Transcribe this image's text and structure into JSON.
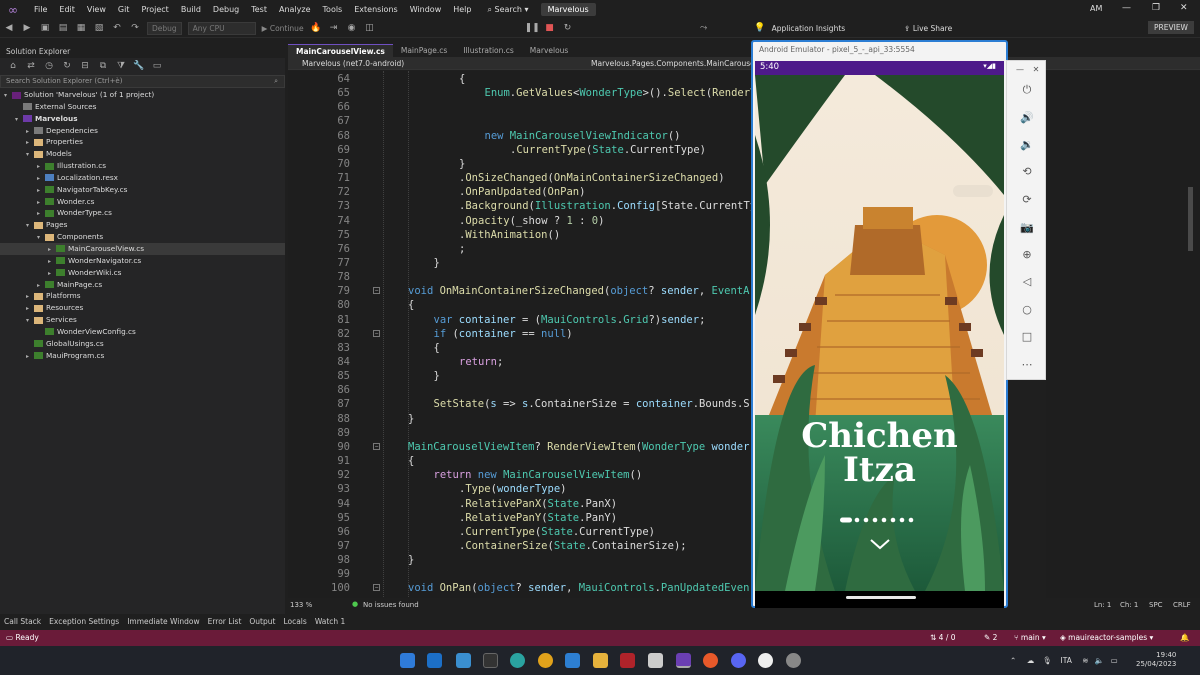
{
  "menubar": {
    "items": [
      "File",
      "Edit",
      "View",
      "Git",
      "Project",
      "Build",
      "Debug",
      "Test",
      "Analyze",
      "Tools",
      "Extensions",
      "Window",
      "Help"
    ],
    "search_label": "Search",
    "solution_badge": "Marvelous",
    "user_initials": "AM"
  },
  "toolbar": {
    "config": "Debug",
    "platform": "Any CPU",
    "continue_label": "Continue",
    "insights_label": "Application Insights",
    "live_share_label": "Live Share",
    "preview_label": "PREVIEW"
  },
  "solution_explorer": {
    "title": "Solution Explorer",
    "search_placeholder": "Search Solution Explorer (Ctrl+è)",
    "tree": [
      {
        "label": "Solution 'Marvelous' (1 of 1 project)",
        "indent": 0,
        "icon": "solution-icon",
        "arrow": "▾"
      },
      {
        "label": "External Sources",
        "indent": 1,
        "icon": "references-icon",
        "arrow": ""
      },
      {
        "label": "Marvelous",
        "indent": 1,
        "icon": "project-icon",
        "arrow": "▾",
        "bold": true
      },
      {
        "label": "Dependencies",
        "indent": 2,
        "icon": "references-icon",
        "arrow": "▸"
      },
      {
        "label": "Properties",
        "indent": 2,
        "icon": "folder-icon",
        "arrow": "▸"
      },
      {
        "label": "Models",
        "indent": 2,
        "icon": "folder-icon",
        "arrow": "▾"
      },
      {
        "label": "Illustration.cs",
        "indent": 3,
        "icon": "csharp-file-icon",
        "arrow": "▸"
      },
      {
        "label": "Localization.resx",
        "indent": 3,
        "icon": "resource-file-icon",
        "arrow": "▸"
      },
      {
        "label": "NavigatorTabKey.cs",
        "indent": 3,
        "icon": "csharp-file-icon",
        "arrow": "▸"
      },
      {
        "label": "Wonder.cs",
        "indent": 3,
        "icon": "csharp-file-icon",
        "arrow": "▸"
      },
      {
        "label": "WonderType.cs",
        "indent": 3,
        "icon": "csharp-file-icon",
        "arrow": "▸"
      },
      {
        "label": "Pages",
        "indent": 2,
        "icon": "folder-icon",
        "arrow": "▾"
      },
      {
        "label": "Components",
        "indent": 3,
        "icon": "folder-icon",
        "arrow": "▾"
      },
      {
        "label": "MainCarouselView.cs",
        "indent": 4,
        "icon": "csharp-file-icon",
        "arrow": "▸",
        "selected": true
      },
      {
        "label": "WonderNavigator.cs",
        "indent": 4,
        "icon": "csharp-file-icon",
        "arrow": "▸"
      },
      {
        "label": "WonderWiki.cs",
        "indent": 4,
        "icon": "csharp-file-icon",
        "arrow": "▸"
      },
      {
        "label": "MainPage.cs",
        "indent": 3,
        "icon": "csharp-file-icon",
        "arrow": "▸"
      },
      {
        "label": "Platforms",
        "indent": 2,
        "icon": "folder-icon",
        "arrow": "▸"
      },
      {
        "label": "Resources",
        "indent": 2,
        "icon": "folder-icon",
        "arrow": "▸"
      },
      {
        "label": "Services",
        "indent": 2,
        "icon": "folder-icon",
        "arrow": "▾"
      },
      {
        "label": "WonderViewConfig.cs",
        "indent": 3,
        "icon": "csharp-file-icon",
        "arrow": ""
      },
      {
        "label": "GlobalUsings.cs",
        "indent": 2,
        "icon": "csharp-file-icon",
        "arrow": ""
      },
      {
        "label": "MauiProgram.cs",
        "indent": 2,
        "icon": "csharp-file-icon",
        "arrow": "▸"
      }
    ]
  },
  "editor": {
    "tabs": [
      "MainCarouselView.cs",
      "MainPage.cs",
      "Illustration.cs",
      "Marvelous"
    ],
    "nav_project": "Marvelous (net7.0-android)",
    "nav_member": "Marvelous.Pages.Components.MainCarouselView",
    "zoom": "133 %",
    "issues": "No issues found",
    "cursor_line": "Ln: 1",
    "cursor_col": "Ch: 1",
    "whitespace": "SPC",
    "line_ending": "CRLF",
    "lines": [
      {
        "n": "64",
        "indent": 2,
        "fold": false,
        "t": [
          [
            "{",
            "p"
          ]
        ]
      },
      {
        "n": "65",
        "indent": 3,
        "fold": false,
        "t": [
          [
            "Enum",
            "ty"
          ],
          [
            ".",
            "p"
          ],
          [
            "GetValues",
            "m"
          ],
          [
            "<",
            "p"
          ],
          [
            "WonderType",
            "ty"
          ],
          [
            ">().",
            "p"
          ],
          [
            "Select",
            "m"
          ],
          [
            "(",
            "p"
          ],
          [
            "RenderView",
            "m"
          ]
        ]
      },
      {
        "n": "66",
        "indent": 0,
        "fold": false,
        "t": []
      },
      {
        "n": "67",
        "indent": 0,
        "fold": false,
        "t": []
      },
      {
        "n": "68",
        "indent": 3,
        "fold": false,
        "t": [
          [
            "new ",
            "k"
          ],
          [
            "MainCarouselViewIndicator",
            "ty"
          ],
          [
            "()",
            "p"
          ]
        ]
      },
      {
        "n": "69",
        "indent": 4,
        "fold": false,
        "t": [
          [
            ".",
            "p"
          ],
          [
            "CurrentType",
            "m"
          ],
          [
            "(",
            "p"
          ],
          [
            "State",
            "ty"
          ],
          [
            ".CurrentType)",
            "p"
          ]
        ]
      },
      {
        "n": "70",
        "indent": 2,
        "fold": false,
        "t": [
          [
            "}",
            "p"
          ]
        ]
      },
      {
        "n": "71",
        "indent": 2,
        "fold": false,
        "t": [
          [
            ".",
            "p"
          ],
          [
            "OnSizeChanged",
            "m"
          ],
          [
            "(",
            "p"
          ],
          [
            "OnMainContainerSizeChanged",
            "m"
          ],
          [
            ")",
            "p"
          ]
        ]
      },
      {
        "n": "72",
        "indent": 2,
        "fold": false,
        "t": [
          [
            ".",
            "p"
          ],
          [
            "OnPanUpdated",
            "m"
          ],
          [
            "(",
            "p"
          ],
          [
            "OnPan",
            "m"
          ],
          [
            ")",
            "p"
          ]
        ]
      },
      {
        "n": "73",
        "indent": 2,
        "fold": false,
        "t": [
          [
            ".",
            "p"
          ],
          [
            "Background",
            "m"
          ],
          [
            "(",
            "p"
          ],
          [
            "Illustration",
            "ty"
          ],
          [
            ".",
            "p"
          ],
          [
            "Config",
            "v"
          ],
          [
            "[State.CurrentType]",
            "p"
          ]
        ]
      },
      {
        "n": "74",
        "indent": 2,
        "fold": false,
        "t": [
          [
            ".",
            "p"
          ],
          [
            "Opacity",
            "m"
          ],
          [
            "(_show ? ",
            "p"
          ],
          [
            "1",
            "n"
          ],
          [
            " : ",
            "p"
          ],
          [
            "0",
            "n"
          ],
          [
            ")",
            "p"
          ]
        ]
      },
      {
        "n": "75",
        "indent": 2,
        "fold": false,
        "t": [
          [
            ".",
            "p"
          ],
          [
            "WithAnimation",
            "m"
          ],
          [
            "()",
            "p"
          ]
        ]
      },
      {
        "n": "76",
        "indent": 2,
        "fold": false,
        "t": [
          [
            ";",
            "p"
          ]
        ]
      },
      {
        "n": "77",
        "indent": 1,
        "fold": false,
        "t": [
          [
            "}",
            "p"
          ]
        ]
      },
      {
        "n": "78",
        "indent": 0,
        "fold": false,
        "t": []
      },
      {
        "n": "79",
        "indent": 0,
        "fold": true,
        "t": [
          [
            "void ",
            "k"
          ],
          [
            "OnMainContainerSizeChanged",
            "m"
          ],
          [
            "(",
            "p"
          ],
          [
            "object",
            "k"
          ],
          [
            "? ",
            "p"
          ],
          [
            "sender",
            "v"
          ],
          [
            ", ",
            "p"
          ],
          [
            "EventA",
            "ty"
          ]
        ]
      },
      {
        "n": "80",
        "indent": 0,
        "fold": false,
        "t": [
          [
            "{",
            "p"
          ]
        ]
      },
      {
        "n": "81",
        "indent": 1,
        "fold": false,
        "t": [
          [
            "var ",
            "k"
          ],
          [
            "container",
            "v"
          ],
          [
            " = (",
            "p"
          ],
          [
            "MauiControls",
            "ty"
          ],
          [
            ".",
            "p"
          ],
          [
            "Grid",
            "ty"
          ],
          [
            "?)",
            "p"
          ],
          [
            "sender",
            "v"
          ],
          [
            ";",
            "p"
          ]
        ]
      },
      {
        "n": "82",
        "indent": 1,
        "fold": true,
        "t": [
          [
            "if ",
            "k"
          ],
          [
            "(",
            "p"
          ],
          [
            "container",
            "v"
          ],
          [
            " == ",
            "p"
          ],
          [
            "null",
            "k"
          ],
          [
            ")",
            "p"
          ]
        ]
      },
      {
        "n": "83",
        "indent": 1,
        "fold": false,
        "t": [
          [
            "{",
            "p"
          ]
        ]
      },
      {
        "n": "84",
        "indent": 2,
        "fold": false,
        "t": [
          [
            "return",
            "k2"
          ],
          [
            ";",
            "p"
          ]
        ]
      },
      {
        "n": "85",
        "indent": 1,
        "fold": false,
        "t": [
          [
            "}",
            "p"
          ]
        ]
      },
      {
        "n": "86",
        "indent": 0,
        "fold": false,
        "t": []
      },
      {
        "n": "87",
        "indent": 1,
        "fold": false,
        "t": [
          [
            "SetState",
            "m"
          ],
          [
            "(",
            "p"
          ],
          [
            "s",
            "v"
          ],
          [
            " => ",
            "p"
          ],
          [
            "s",
            "v"
          ],
          [
            ".ContainerSize = ",
            "p"
          ],
          [
            "container",
            "v"
          ],
          [
            ".Bounds.S",
            "p"
          ]
        ]
      },
      {
        "n": "88",
        "indent": 0,
        "fold": false,
        "t": [
          [
            "}",
            "p"
          ]
        ]
      },
      {
        "n": "89",
        "indent": 0,
        "fold": false,
        "t": []
      },
      {
        "n": "90",
        "indent": 0,
        "fold": true,
        "t": [
          [
            "MainCarouselViewItem",
            "ty"
          ],
          [
            "? ",
            "p"
          ],
          [
            "RenderViewItem",
            "m"
          ],
          [
            "(",
            "p"
          ],
          [
            "WonderType",
            "ty"
          ],
          [
            " wonder",
            "v"
          ]
        ]
      },
      {
        "n": "91",
        "indent": 0,
        "fold": false,
        "t": [
          [
            "{",
            "p"
          ]
        ]
      },
      {
        "n": "92",
        "indent": 1,
        "fold": false,
        "t": [
          [
            "return ",
            "k2"
          ],
          [
            "new ",
            "k"
          ],
          [
            "MainCarouselViewItem",
            "ty"
          ],
          [
            "()",
            "p"
          ]
        ]
      },
      {
        "n": "93",
        "indent": 2,
        "fold": false,
        "t": [
          [
            ".",
            "p"
          ],
          [
            "Type",
            "m"
          ],
          [
            "(",
            "p"
          ],
          [
            "wonderType",
            "v"
          ],
          [
            ")",
            "p"
          ]
        ]
      },
      {
        "n": "94",
        "indent": 2,
        "fold": false,
        "t": [
          [
            ".",
            "p"
          ],
          [
            "RelativePanX",
            "m"
          ],
          [
            "(",
            "p"
          ],
          [
            "State",
            "ty"
          ],
          [
            ".PanX)",
            "p"
          ]
        ]
      },
      {
        "n": "95",
        "indent": 2,
        "fold": false,
        "t": [
          [
            ".",
            "p"
          ],
          [
            "RelativePanY",
            "m"
          ],
          [
            "(",
            "p"
          ],
          [
            "State",
            "ty"
          ],
          [
            ".PanY)",
            "p"
          ]
        ]
      },
      {
        "n": "96",
        "indent": 2,
        "fold": false,
        "t": [
          [
            ".",
            "p"
          ],
          [
            "CurrentType",
            "m"
          ],
          [
            "(",
            "p"
          ],
          [
            "State",
            "ty"
          ],
          [
            ".CurrentType)",
            "p"
          ]
        ]
      },
      {
        "n": "97",
        "indent": 2,
        "fold": false,
        "t": [
          [
            ".",
            "p"
          ],
          [
            "ContainerSize",
            "m"
          ],
          [
            "(",
            "p"
          ],
          [
            "State",
            "ty"
          ],
          [
            ".ContainerSize);",
            "p"
          ]
        ]
      },
      {
        "n": "98",
        "indent": 0,
        "fold": false,
        "t": [
          [
            "}",
            "p"
          ]
        ]
      },
      {
        "n": "99",
        "indent": 0,
        "fold": false,
        "t": []
      },
      {
        "n": "100",
        "indent": 0,
        "fold": true,
        "t": [
          [
            "void ",
            "k"
          ],
          [
            "OnPan",
            "m"
          ],
          [
            "(",
            "p"
          ],
          [
            "object",
            "k"
          ],
          [
            "? ",
            "p"
          ],
          [
            "sender",
            "v"
          ],
          [
            ", ",
            "p"
          ],
          [
            "MauiControls",
            "ty"
          ],
          [
            ".",
            "p"
          ],
          [
            "PanUpdatedEven",
            "ty"
          ]
        ]
      }
    ]
  },
  "emulator": {
    "title": "Android Emulator - pixel_5_-_api_33:5554",
    "time": "5:40",
    "wonder_name_line1": "Chichen",
    "wonder_name_line2": "Itza",
    "page_count": 8,
    "current_page": 1
  },
  "bottom_tabs": [
    "Call Stack",
    "Exception Settings",
    "Immediate Window",
    "Error List",
    "Output",
    "Locals",
    "Watch 1"
  ],
  "statusbar": {
    "ready": "Ready",
    "changes": "4 / 0",
    "pending": "2",
    "branch": "main",
    "repo": "mauireactor-samples"
  },
  "taskbar": {
    "language": "ITA",
    "time": "19:40",
    "date": "25/04/2023"
  },
  "colors": {
    "accent": "#6f4fc2",
    "statusbar": "#6a1b39",
    "emulator_border": "#2b7dd3",
    "keyword": "#569cd6",
    "keyword_control": "#d8a0df",
    "type": "#4ec9b0",
    "method": "#dcdcaa",
    "variable": "#9cdcfe"
  }
}
